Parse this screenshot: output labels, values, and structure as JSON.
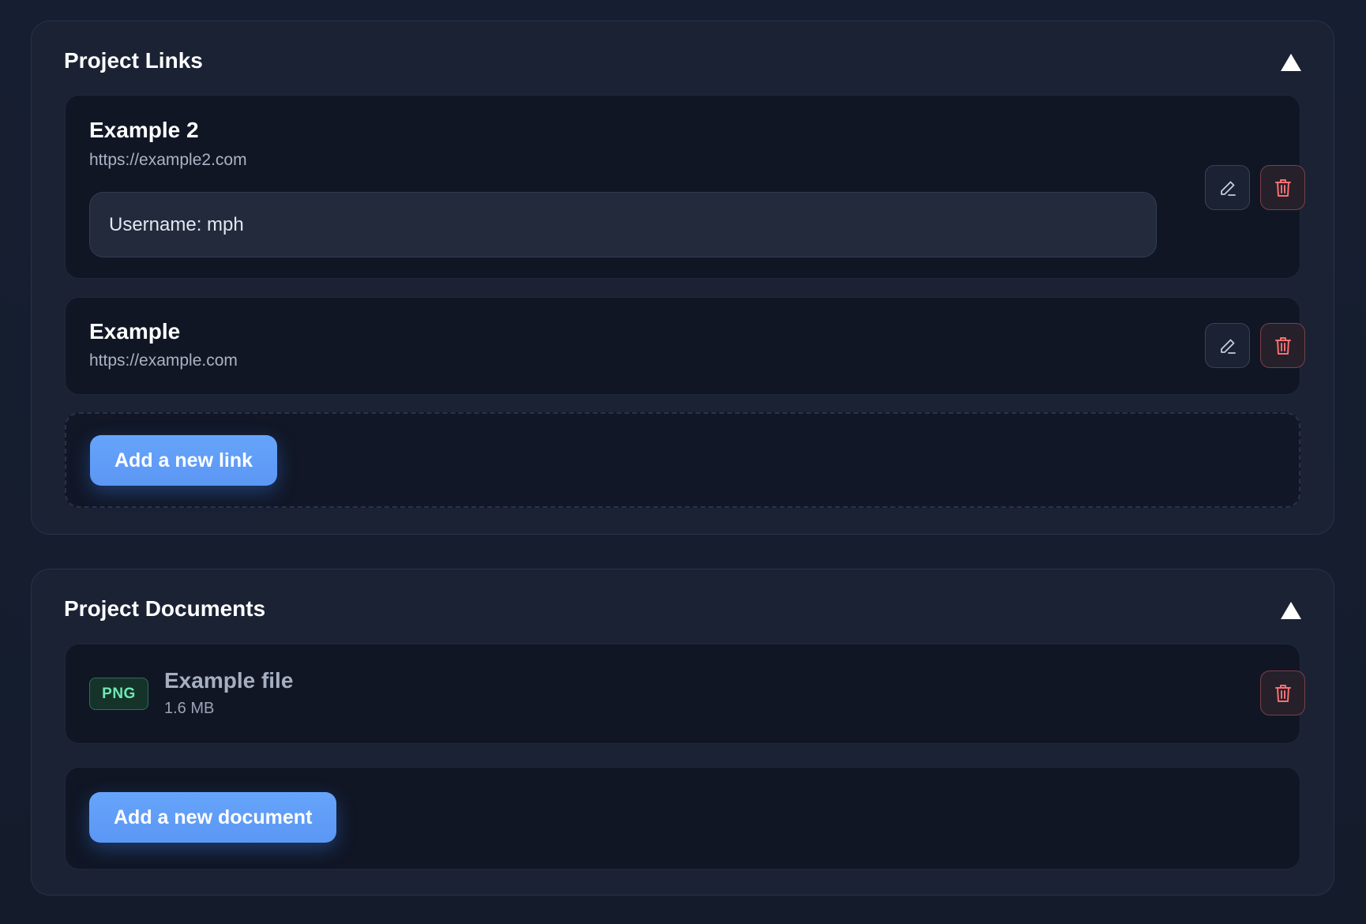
{
  "links_panel": {
    "title": "Project Links",
    "collapse_icon": "triangle-up-icon",
    "links": [
      {
        "title": "Example 2",
        "url": "https://example2.com",
        "note": "Username: mph"
      },
      {
        "title": "Example",
        "url": "https://example.com"
      }
    ],
    "add_button_label": "Add a new link"
  },
  "documents_panel": {
    "title": "Project Documents",
    "collapse_icon": "triangle-up-icon",
    "documents": [
      {
        "type": "PNG",
        "name": "Example file",
        "size": "1.6 MB"
      }
    ],
    "add_button_label": "Add a new document"
  },
  "colors": {
    "background": "#151d2e",
    "panel": "#1a2234",
    "card": "#101624",
    "accent": "#5b97f4",
    "danger": "#f87171",
    "badge_text": "#6ee7b7"
  }
}
